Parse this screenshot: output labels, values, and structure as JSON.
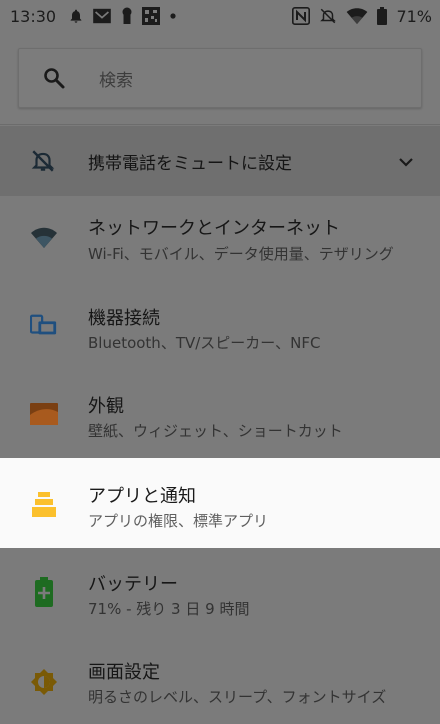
{
  "status_bar": {
    "time": "13:30",
    "battery_percent": "71%"
  },
  "search": {
    "placeholder": "検索"
  },
  "suggestion": {
    "label": "携帯電話をミュートに設定"
  },
  "items": [
    {
      "title": "ネットワークとインターネット",
      "summary": "Wi-Fi、モバイル、データ使用量、テザリング",
      "icon": "wifi-icon",
      "color": "#263238"
    },
    {
      "title": "機器接続",
      "summary": "Bluetooth、TV/スピーカー、NFC",
      "icon": "devices-icon",
      "color": "#1f4f7f"
    },
    {
      "title": "外観",
      "summary": "壁紙、ウィジェット、ショートカット",
      "icon": "wallpaper-icon",
      "color": "#7a3f12"
    },
    {
      "title": "アプリと通知",
      "summary": "アプリの権限、標準アプリ",
      "icon": "apps-icon",
      "color": "#fbc02d"
    },
    {
      "title": "バッテリー",
      "summary": "71% - 残り 3 日 9 時間",
      "icon": "battery-icon",
      "color": "#1e6b21"
    },
    {
      "title": "画面設定",
      "summary": "明るさのレベル、スリープ、フォントサイズ",
      "icon": "brightness-icon",
      "color": "#7a5a06"
    }
  ]
}
